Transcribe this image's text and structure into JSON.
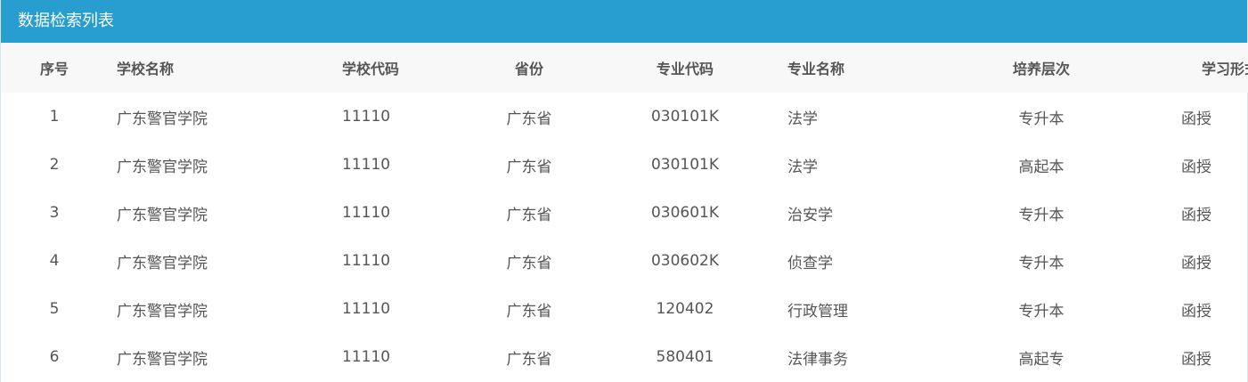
{
  "panel": {
    "title": "数据检索列表"
  },
  "table": {
    "columns": [
      "序号",
      "学校名称",
      "学校代码",
      "省份",
      "专业代码",
      "专业名称",
      "培养层次",
      "学习形式"
    ],
    "rows": [
      [
        "1",
        "广东警官学院",
        "11110",
        "广东省",
        "030101K",
        "法学",
        "专升本",
        "函授"
      ],
      [
        "2",
        "广东警官学院",
        "11110",
        "广东省",
        "030101K",
        "法学",
        "高起本",
        "函授"
      ],
      [
        "3",
        "广东警官学院",
        "11110",
        "广东省",
        "030601K",
        "治安学",
        "专升本",
        "函授"
      ],
      [
        "4",
        "广东警官学院",
        "11110",
        "广东省",
        "030602K",
        "侦查学",
        "专升本",
        "函授"
      ],
      [
        "5",
        "广东警官学院",
        "11110",
        "广东省",
        "120402",
        "行政管理",
        "专升本",
        "函授"
      ],
      [
        "6",
        "广东警官学院",
        "11110",
        "广东省",
        "580401",
        "法律事务",
        "高起专",
        "函授"
      ]
    ]
  },
  "colors": {
    "header_bg": "#279dd0",
    "table_head_bg": "#f8f8f8",
    "text": "#555555"
  }
}
